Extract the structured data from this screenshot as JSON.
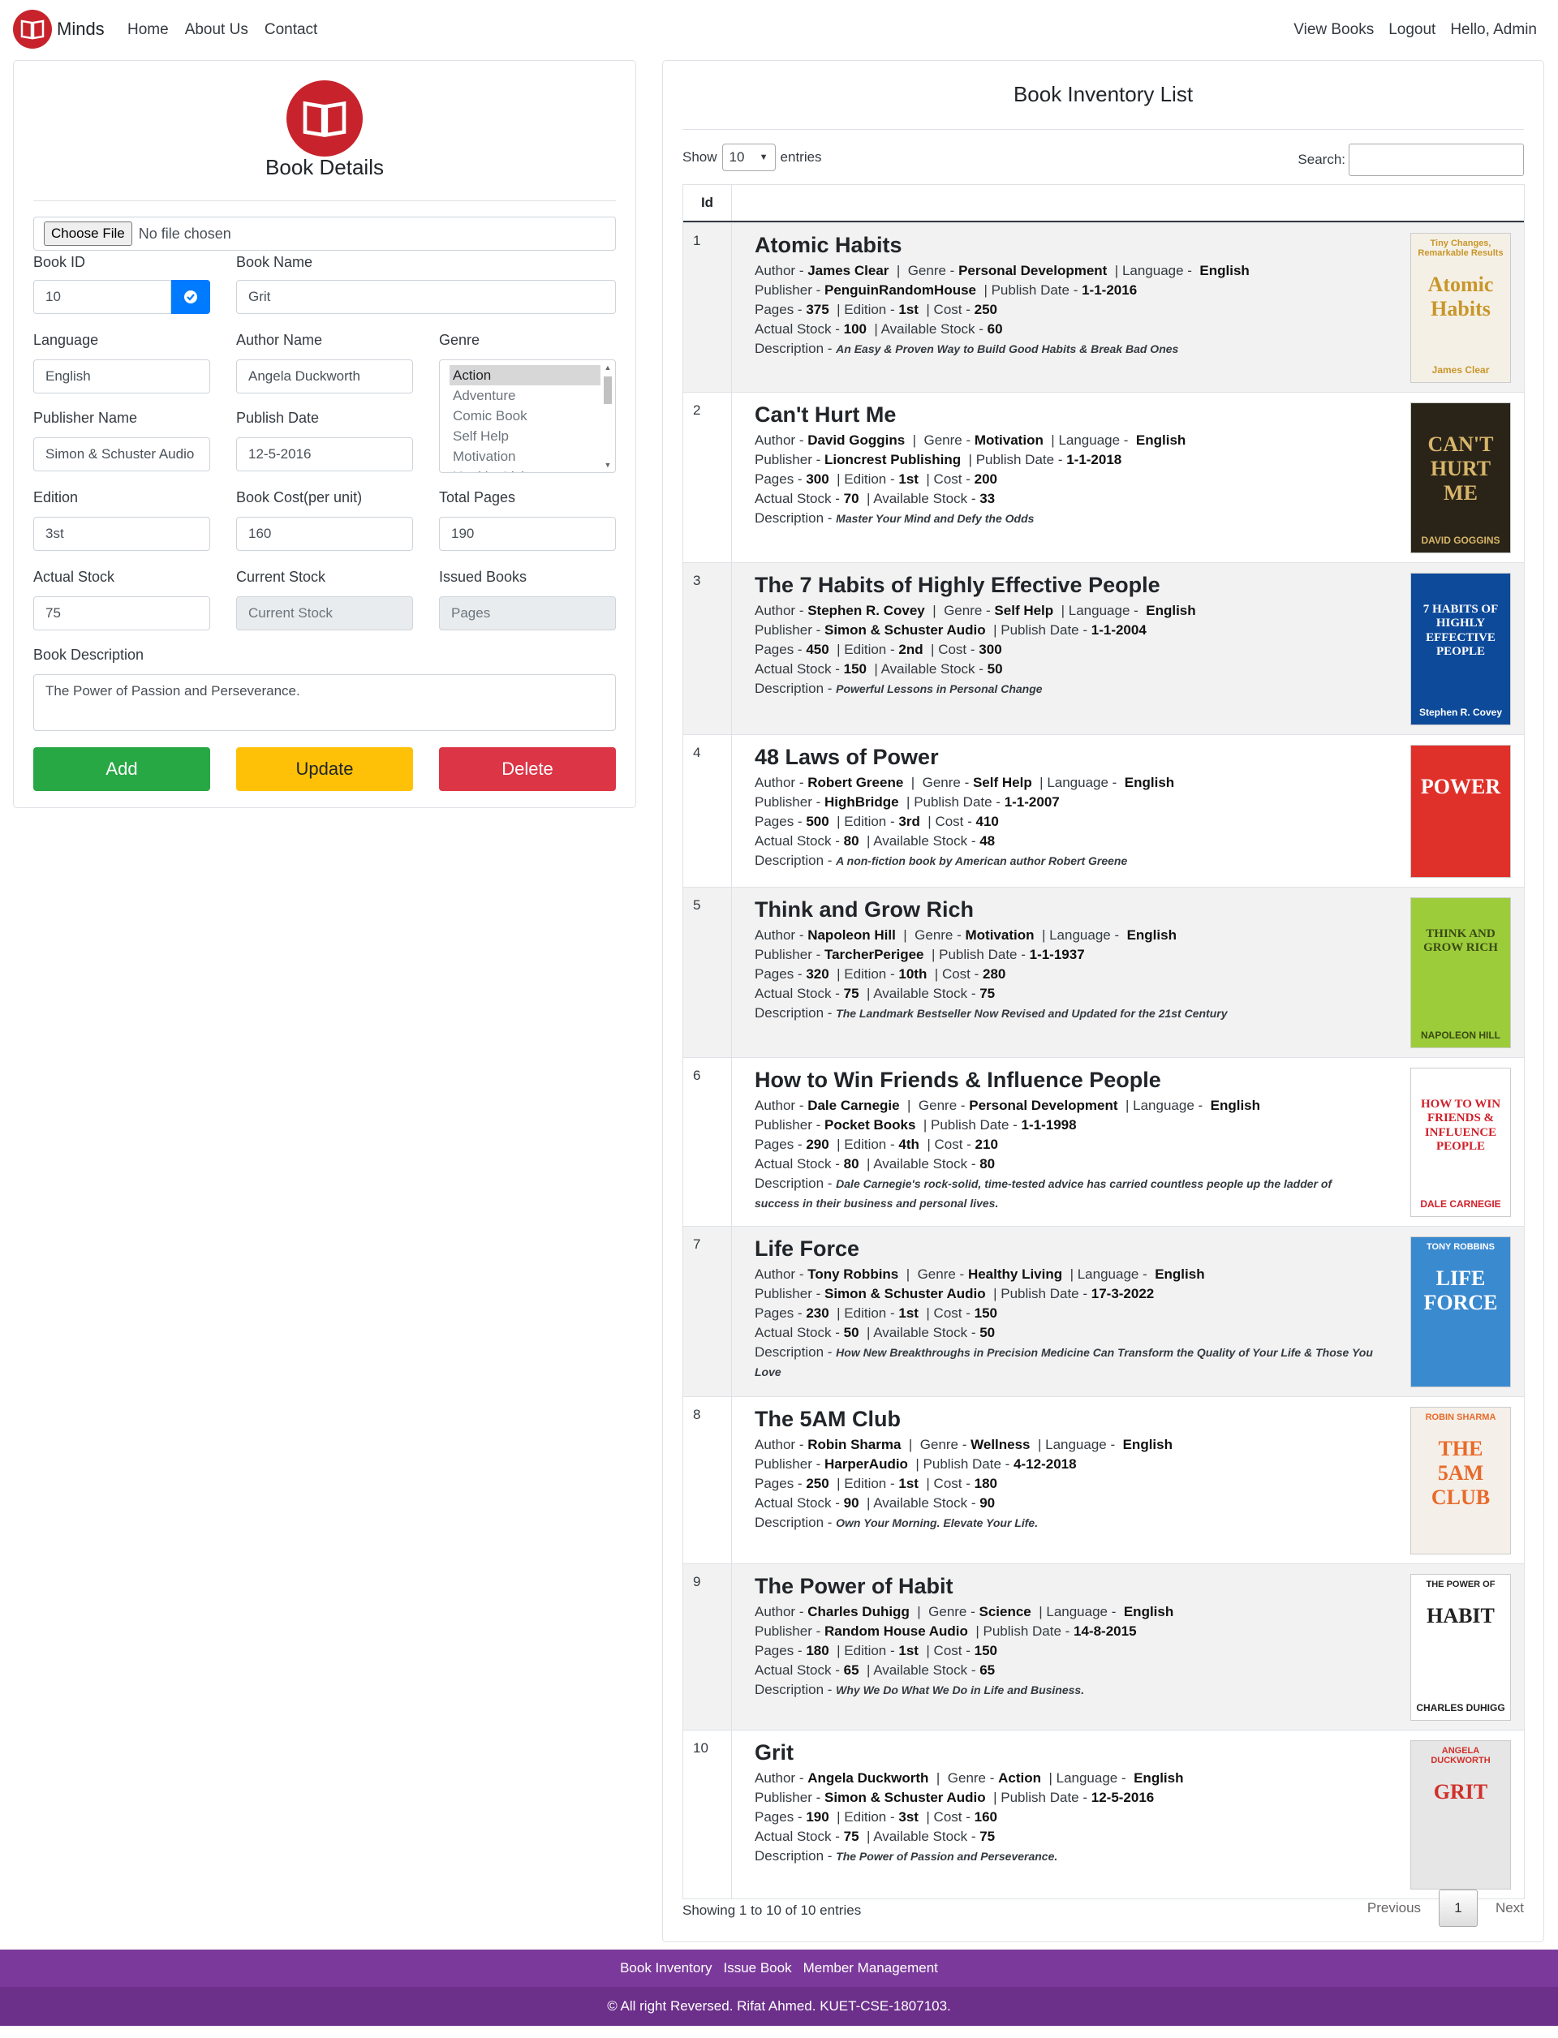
{
  "nav": {
    "brand": "Minds",
    "links_left": [
      "Home",
      "About Us",
      "Contact"
    ],
    "links_right": [
      "View Books",
      "Logout",
      "Hello, Admin"
    ]
  },
  "form": {
    "title": "Book Details",
    "file_button": "Choose File",
    "file_status": "No file chosen",
    "book_id_label": "Book ID",
    "book_id": "10",
    "book_name_label": "Book Name",
    "book_name": "Grit",
    "language_label": "Language",
    "language": "English",
    "author_label": "Author Name",
    "author": "Angela Duckworth",
    "genre_label": "Genre",
    "genre_options": [
      "Action",
      "Adventure",
      "Comic Book",
      "Self Help",
      "Motivation",
      "Healthy Living"
    ],
    "publisher_label": "Publisher Name",
    "publisher": "Simon & Schuster Audio",
    "publish_date_label": "Publish Date",
    "publish_date": "12-5-2016",
    "edition_label": "Edition",
    "edition": "3st",
    "cost_label": "Book Cost(per unit)",
    "cost": "160",
    "pages_label": "Total Pages",
    "pages": "190",
    "actual_stock_label": "Actual Stock",
    "actual_stock": "75",
    "current_stock_label": "Current Stock",
    "current_stock_placeholder": "Current Stock",
    "issued_label": "Issued Books",
    "issued_placeholder": "Pages",
    "desc_label": "Book Description",
    "description": "The Power of Passion and Perseverance.",
    "add": "Add",
    "update": "Update",
    "delete": "Delete"
  },
  "inventory": {
    "title": "Book Inventory List",
    "show_label": "Show",
    "entries_value": "10",
    "entries_label": "entries",
    "search_label": "Search:",
    "id_header": "Id",
    "labels": {
      "author": "Author",
      "genre": "Genre",
      "language": "Language",
      "publisher": "Publisher",
      "publish_date": "Publish Date",
      "pages": "Pages",
      "edition": "Edition",
      "cost": "Cost",
      "actual_stock": "Actual Stock",
      "available_stock": "Available Stock",
      "description": "Description"
    },
    "books": [
      {
        "id": "1",
        "name": "Atomic Habits",
        "author": "James Clear",
        "genre": "Personal Development",
        "language": "English",
        "publisher": "PenguinRandomHouse",
        "date": "1-1-2016",
        "pages": "375",
        "edition": "1st",
        "cost": "250",
        "actual": "100",
        "available": "60",
        "desc": "An Easy & Proven Way to Build Good Habits & Break Bad Ones"
      },
      {
        "id": "2",
        "name": "Can't Hurt Me",
        "author": "David Goggins",
        "genre": "Motivation",
        "language": "English",
        "publisher": "Lioncrest Publishing",
        "date": "1-1-2018",
        "pages": "300",
        "edition": "1st",
        "cost": "200",
        "actual": "70",
        "available": "33",
        "desc": "Master Your Mind and Defy the Odds"
      },
      {
        "id": "3",
        "name": "The 7 Habits of Highly Effective People",
        "author": "Stephen R. Covey",
        "genre": "Self Help",
        "language": "English",
        "publisher": "Simon & Schuster Audio",
        "date": "1-1-2004",
        "pages": "450",
        "edition": "2nd",
        "cost": "300",
        "actual": "150",
        "available": "50",
        "desc": "Powerful Lessons in Personal Change"
      },
      {
        "id": "4",
        "name": "48 Laws of Power",
        "author": "Robert Greene",
        "genre": "Self Help",
        "language": "English",
        "publisher": "HighBridge",
        "date": "1-1-2007",
        "pages": "500",
        "edition": "3rd",
        "cost": "410",
        "actual": "80",
        "available": "48",
        "desc": "A non-fiction book by American author Robert Greene"
      },
      {
        "id": "5",
        "name": "Think and Grow Rich",
        "author": "Napoleon Hill",
        "genre": "Motivation",
        "language": "English",
        "publisher": "TarcherPerigee",
        "date": "1-1-1937",
        "pages": "320",
        "edition": "10th",
        "cost": "280",
        "actual": "75",
        "available": "75",
        "desc": "The Landmark Bestseller Now Revised and Updated for the 21st Century"
      },
      {
        "id": "6",
        "name": "How to Win Friends & Influence People",
        "author": "Dale Carnegie",
        "genre": "Personal Development",
        "language": "English",
        "publisher": "Pocket Books",
        "date": "1-1-1998",
        "pages": "290",
        "edition": "4th",
        "cost": "210",
        "actual": "80",
        "available": "80",
        "desc": "Dale Carnegie's rock-solid, time-tested advice has carried countless people up the ladder of success in their business and personal lives."
      },
      {
        "id": "7",
        "name": "Life Force",
        "author": "Tony Robbins",
        "genre": "Healthy Living",
        "language": "English",
        "publisher": "Simon & Schuster Audio",
        "date": "17-3-2022",
        "pages": "230",
        "edition": "1st",
        "cost": "150",
        "actual": "50",
        "available": "50",
        "desc": "How New Breakthroughs in Precision Medicine Can Transform the Quality of Your Life & Those You Love"
      },
      {
        "id": "8",
        "name": "The 5AM Club",
        "author": "Robin Sharma",
        "genre": "Wellness",
        "language": "English",
        "publisher": "HarperAudio",
        "date": "4-12-2018",
        "pages": "250",
        "edition": "1st",
        "cost": "180",
        "actual": "90",
        "available": "90",
        "desc": "Own Your Morning. Elevate Your Life."
      },
      {
        "id": "9",
        "name": "The Power of Habit",
        "author": "Charles Duhigg",
        "genre": "Science",
        "language": "English",
        "publisher": "Random House Audio",
        "date": "14-8-2015",
        "pages": "180",
        "edition": "1st",
        "cost": "150",
        "actual": "65",
        "available": "65",
        "desc": "Why We Do What We Do in Life and Business."
      },
      {
        "id": "10",
        "name": "Grit",
        "author": "Angela Duckworth",
        "genre": "Action",
        "language": "English",
        "publisher": "Simon & Schuster Audio",
        "date": "12-5-2016",
        "pages": "190",
        "edition": "3st",
        "cost": "160",
        "actual": "75",
        "available": "75",
        "desc": "The Power of Passion and Perseverance."
      }
    ],
    "covers": [
      {
        "top": "Tiny Changes, Remarkable Results",
        "main": "Atomic Habits",
        "foot": "James Clear",
        "bg": "#f5f0e6",
        "fg": "#c8962a"
      },
      {
        "top": "",
        "main": "CAN'T HURT ME",
        "foot": "DAVID GOGGINS",
        "bg": "#2a2418",
        "fg": "#d8b56a"
      },
      {
        "top": "",
        "main": "7 HABITS OF HIGHLY EFFECTIVE PEOPLE",
        "foot": "Stephen R. Covey",
        "bg": "#0d4a9a",
        "fg": "#ffffff"
      },
      {
        "top": "",
        "main": "POWER",
        "foot": "",
        "bg": "#e0302a",
        "fg": "#ffffff"
      },
      {
        "top": "",
        "main": "THINK AND GROW RICH",
        "foot": "NAPOLEON HILL",
        "bg": "#9ccc3a",
        "fg": "#3a4a14"
      },
      {
        "top": "",
        "main": "HOW TO WIN FRIENDS & INFLUENCE PEOPLE",
        "foot": "DALE CARNEGIE",
        "bg": "#ffffff",
        "fg": "#d0202a"
      },
      {
        "top": "TONY ROBBINS",
        "main": "LIFE FORCE",
        "foot": "",
        "bg": "#3a8ad0",
        "fg": "#ffffff"
      },
      {
        "top": "ROBIN SHARMA",
        "main": "THE 5AM CLUB",
        "foot": "",
        "bg": "#f4efe8",
        "fg": "#e86a2a"
      },
      {
        "top": "THE POWER OF",
        "main": "HABIT",
        "foot": "CHARLES DUHIGG",
        "bg": "#ffffff",
        "fg": "#222222"
      },
      {
        "top": "ANGELA DUCKWORTH",
        "main": "GRIT",
        "foot": "",
        "bg": "#e6e6e6",
        "fg": "#d0302a"
      }
    ],
    "showing_text": "Showing 1 to 10 of 10 entries",
    "previous": "Previous",
    "page": "1",
    "next": "Next"
  },
  "footer": {
    "links": [
      "Book Inventory",
      "Issue Book",
      "Member Management"
    ],
    "copyright": "© All right Reversed. Rifat Ahmed. KUET-CSE-1807103."
  },
  "colors": {
    "primary": "#007bff",
    "success": "#28a745",
    "warning": "#ffc107",
    "danger": "#dc3545",
    "brand": "#c8232c",
    "footer": "#7b3a9b"
  }
}
